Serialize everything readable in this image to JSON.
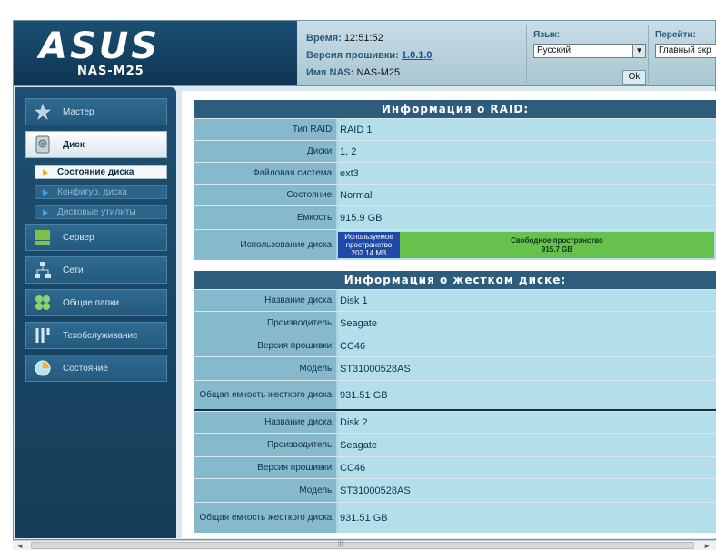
{
  "brand": {
    "logo": "ASUS",
    "model": "NAS-M25"
  },
  "header": {
    "time_label": "Время:",
    "time_value": "12:51:52",
    "firmware_label": "Версия прошивки:",
    "firmware_value": "1.0.1.0",
    "nas_name_label": "Имя NAS:",
    "nas_name_value": "NAS-M25",
    "language_label": "Язык:",
    "language_value": "Русский",
    "ok_label": "Ok",
    "goto_label": "Перейти:",
    "goto_value": "Главный экр"
  },
  "sidebar": {
    "items": [
      {
        "label": "Мастер",
        "icon": "wizard-icon"
      },
      {
        "label": "Диск",
        "icon": "disk-icon"
      },
      {
        "label": "Сервер",
        "icon": "server-icon"
      },
      {
        "label": "Сети",
        "icon": "network-icon"
      },
      {
        "label": "Общие папки",
        "icon": "shared-folders-icon"
      },
      {
        "label": "Техобслуживание",
        "icon": "maintenance-icon"
      },
      {
        "label": "Состояние",
        "icon": "status-icon"
      }
    ],
    "subitems": [
      {
        "label": "Состояние диска"
      },
      {
        "label": "Конфигур. диска"
      },
      {
        "label": "Дисковые утилиты"
      }
    ]
  },
  "raid": {
    "title": "Информация о RAID:",
    "rows": [
      {
        "key": "Тип RAID:",
        "value": "RAID 1"
      },
      {
        "key": "Диски:",
        "value": "1, 2"
      },
      {
        "key": "Файловая система:",
        "value": "ext3"
      },
      {
        "key": "Состояние:",
        "value": "Normal"
      },
      {
        "key": "Емкость:",
        "value": "915.9 GB"
      }
    ],
    "usage_key": "Использование диска:",
    "used_label": "Используемое пространство",
    "used_value": "202.14 MB",
    "free_label": "Свободное пространство",
    "free_value": "915.7 GB"
  },
  "hdd": {
    "title": "Информация о жестком диске:",
    "disks": [
      {
        "rows": [
          {
            "key": "Название диска:",
            "value": "Disk 1"
          },
          {
            "key": "Производитель:",
            "value": "Seagate"
          },
          {
            "key": "Версия прошивки:",
            "value": "CC46"
          },
          {
            "key": "Модель:",
            "value": "ST31000528AS"
          },
          {
            "key": "Общая емкость жесткого диска:",
            "value": "931.51 GB"
          }
        ]
      },
      {
        "rows": [
          {
            "key": "Название диска:",
            "value": "Disk 2"
          },
          {
            "key": "Производитель:",
            "value": "Seagate"
          },
          {
            "key": "Версия прошивки:",
            "value": "CC46"
          },
          {
            "key": "Модель:",
            "value": "ST31000528AS"
          },
          {
            "key": "Общая емкость жесткого диска:",
            "value": "931.51 GB"
          }
        ]
      }
    ]
  }
}
